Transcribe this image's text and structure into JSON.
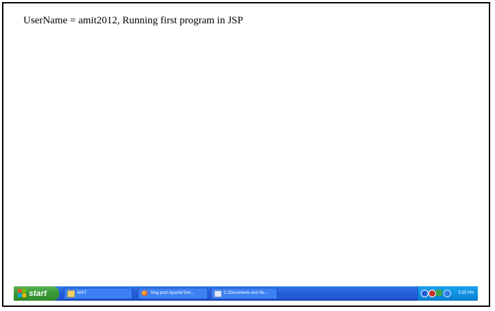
{
  "page": {
    "text": "UserName = amit2012, Running first program in JSP"
  },
  "taskbar": {
    "start_label": "start",
    "tasks": [
      {
        "label": "AMIT",
        "icon": "folder-icon"
      },
      {
        "label": "blog post:ApacheTom...",
        "icon": "firefox-icon"
      },
      {
        "label": "C:\\Documents and Se...",
        "icon": "document-icon"
      }
    ],
    "clock": "5:55 PM",
    "tray_icons": [
      "network-icon",
      "shield-icon",
      "volume-icon",
      "messenger-icon"
    ]
  }
}
